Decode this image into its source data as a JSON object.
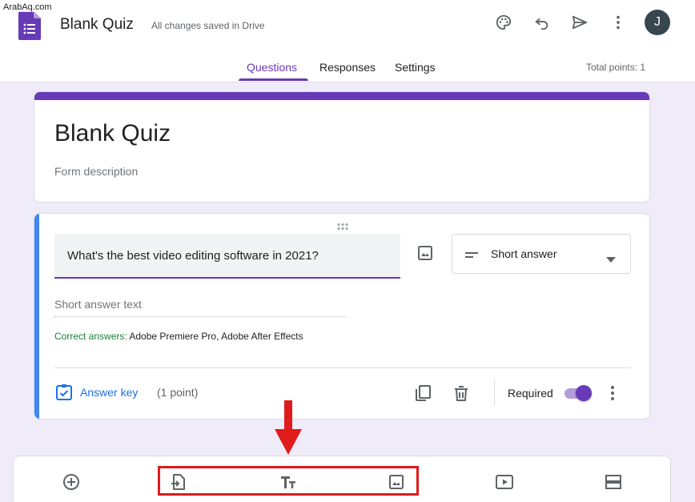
{
  "watermark": "ArabAq.com",
  "header": {
    "title": "Blank Quiz",
    "save_status": "All changes saved in Drive",
    "avatar_letter": "J",
    "icons": [
      "palette-icon",
      "undo-icon",
      "send-icon",
      "more-vert-icon"
    ]
  },
  "tabs": [
    {
      "label": "Questions",
      "active": true
    },
    {
      "label": "Responses",
      "active": false
    },
    {
      "label": "Settings",
      "active": false
    }
  ],
  "total_points": "Total points: 1",
  "form": {
    "title": "Blank Quiz",
    "description_placeholder": "Form description"
  },
  "question": {
    "text": "What's the best video editing software in 2021?",
    "type": "Short answer",
    "answer_placeholder": "Short answer text",
    "correct_label": "Correct answers:",
    "correct_values": "Adobe Premiere Pro, Adobe After Effects",
    "answer_key_label": "Answer key",
    "points": "(1 point)",
    "required_label": "Required",
    "required": true
  },
  "toolbar": {
    "items": [
      "add-question",
      "import-questions",
      "add-title-description",
      "add-image",
      "add-video",
      "add-section"
    ]
  },
  "colors": {
    "accent": "#673ab7",
    "background": "#f0ebf8",
    "link": "#1a73e8",
    "correct": "#188038",
    "annotation": "#e01b1b"
  }
}
